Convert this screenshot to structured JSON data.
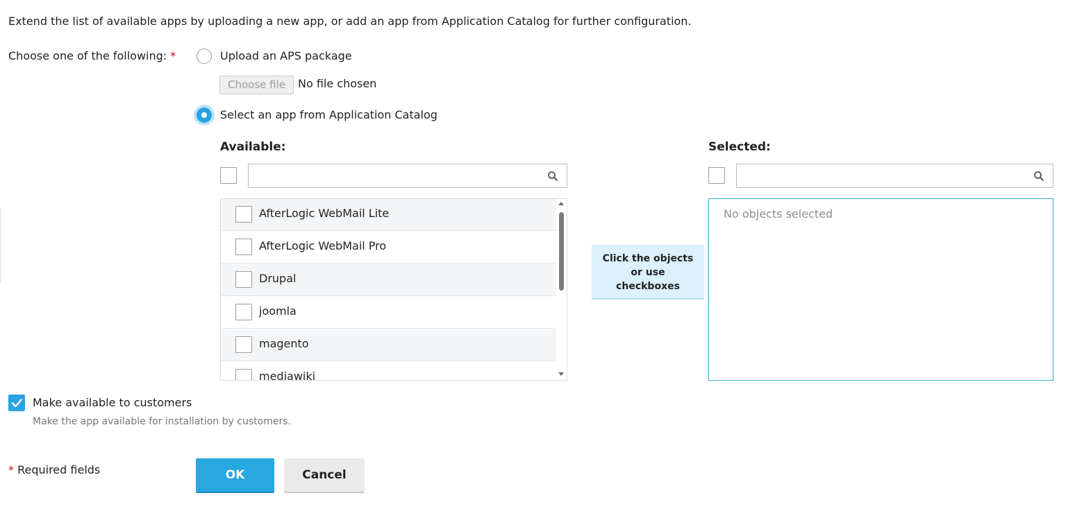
{
  "intro_text": "Extend the list of available apps by uploading a new app, or add an app from Application Catalog for further configuration.",
  "choose": {
    "label": "Choose one of the following:",
    "required_mark": "*",
    "option_upload": "Upload an APS package",
    "option_catalog": "Select an app from Application Catalog",
    "selected_option": "Select an app from Application Catalog"
  },
  "file_input": {
    "button_label": "Choose file",
    "status": "No file chosen"
  },
  "available": {
    "title": "Available:",
    "search_placeholder": "",
    "items": [
      {
        "label": "AfterLogic WebMail Lite",
        "checked": false
      },
      {
        "label": "AfterLogic WebMail Pro",
        "checked": false
      },
      {
        "label": "Drupal",
        "checked": false
      },
      {
        "label": "joomla",
        "checked": false
      },
      {
        "label": "magento",
        "checked": false
      },
      {
        "label": "mediawiki",
        "checked": false
      }
    ]
  },
  "hint": {
    "line1": "Click the objects",
    "line2": "or use",
    "line3": "checkboxes"
  },
  "selected": {
    "title": "Selected:",
    "search_placeholder": "",
    "empty_text": "No objects selected"
  },
  "make_available": {
    "label": "Make available to customers",
    "description": "Make the app available for installation by customers.",
    "checked": true
  },
  "footer": {
    "required_mark": "*",
    "required_text": "Required fields",
    "ok_label": "OK",
    "cancel_label": "Cancel"
  },
  "colors": {
    "accent": "#29a3e0",
    "required": "#d0021b",
    "hint_bg": "#dbf1fc",
    "selected_border": "#3aa9c9"
  }
}
